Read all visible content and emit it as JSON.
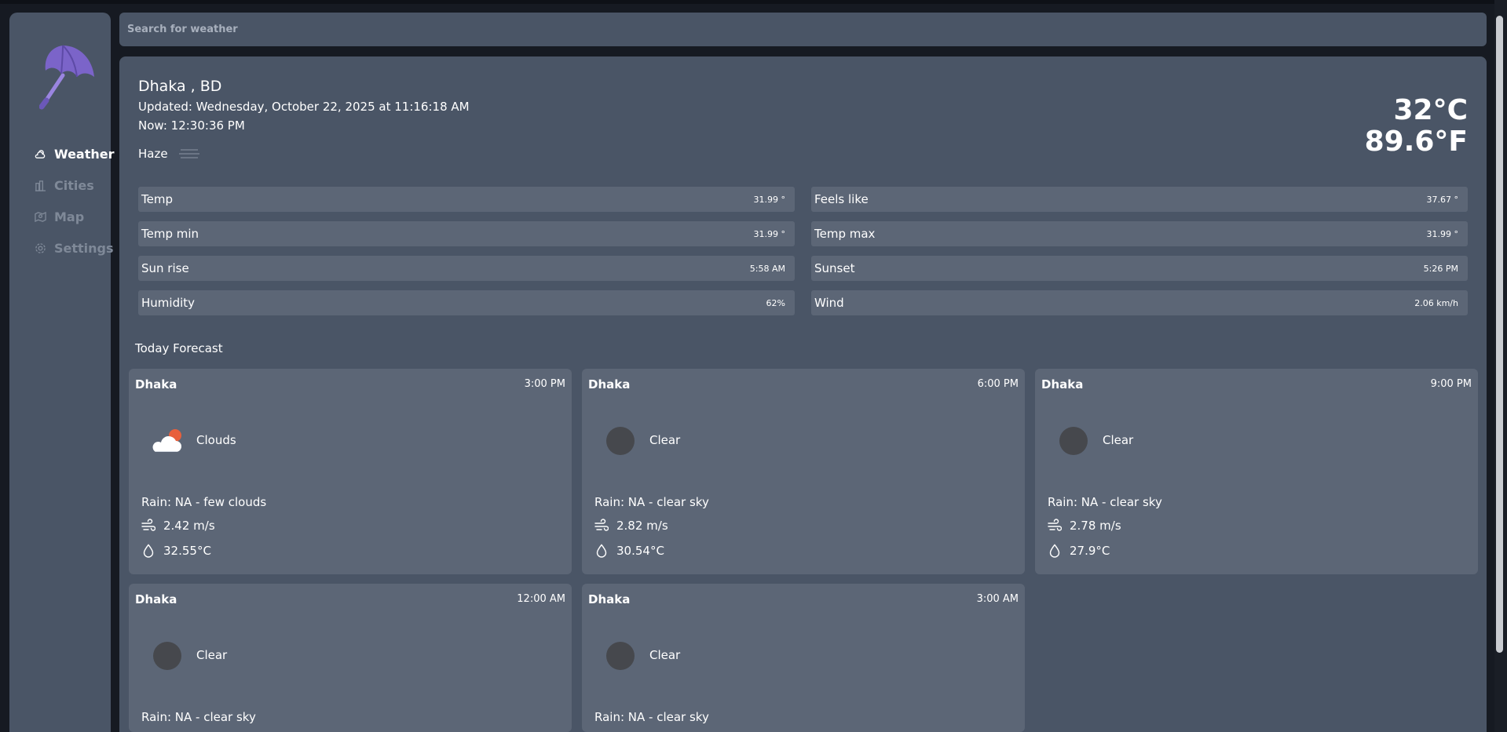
{
  "search": {
    "placeholder": "Search for weather"
  },
  "sidebar": {
    "logo_icon": "umbrella-icon",
    "items": [
      {
        "label": "Weather",
        "icon": "weather-icon",
        "active": true
      },
      {
        "label": "Cities",
        "icon": "cities-icon",
        "active": false
      },
      {
        "label": "Map",
        "icon": "map-icon",
        "active": false
      },
      {
        "label": "Settings",
        "icon": "gear-icon",
        "active": false
      }
    ]
  },
  "current": {
    "location": "Dhaka , BD",
    "updated": "Updated: Wednesday, October 22, 2025 at 11:16:18 AM",
    "now": "Now: 12:30:36 PM",
    "condition": "Haze",
    "condition_icon": "haze-icon",
    "temp_c": "32°C",
    "temp_f": "89.6°F"
  },
  "stats": [
    {
      "label": "Temp",
      "value": "31.99 °"
    },
    {
      "label": "Feels like",
      "value": "37.67 °"
    },
    {
      "label": "Temp min",
      "value": "31.99 °"
    },
    {
      "label": "Temp max",
      "value": "31.99 °"
    },
    {
      "label": "Sun rise",
      "value": "5:58 AM"
    },
    {
      "label": "Sunset",
      "value": "5:26 PM"
    },
    {
      "label": "Humidity",
      "value": "62%"
    },
    {
      "label": "Wind",
      "value": "2.06 km/h"
    }
  ],
  "forecast": {
    "title": "Today Forecast",
    "cards": [
      {
        "city": "Dhaka",
        "time": "3:00 PM",
        "condition": "Clouds",
        "icon": "clouds-icon",
        "rain": "Rain: NA - few clouds",
        "wind": "2.42 m/s",
        "temp": "32.55°C"
      },
      {
        "city": "Dhaka",
        "time": "6:00 PM",
        "condition": "Clear",
        "icon": "clear-icon",
        "rain": "Rain: NA - clear sky",
        "wind": "2.82 m/s",
        "temp": "30.54°C"
      },
      {
        "city": "Dhaka",
        "time": "9:00 PM",
        "condition": "Clear",
        "icon": "clear-icon",
        "rain": "Rain: NA - clear sky",
        "wind": "2.78 m/s",
        "temp": "27.9°C"
      },
      {
        "city": "Dhaka",
        "time": "12:00 AM",
        "condition": "Clear",
        "icon": "clear-icon",
        "rain": "Rain: NA - clear sky"
      },
      {
        "city": "Dhaka",
        "time": "3:00 AM",
        "condition": "Clear",
        "icon": "clear-icon",
        "rain": "Rain: NA - clear sky"
      }
    ]
  },
  "colors": {
    "background": "#161a22",
    "panel": "#4a5566",
    "card": "#5c6676",
    "muted_nav": "#7f8998",
    "logo": "#7b64c9"
  }
}
